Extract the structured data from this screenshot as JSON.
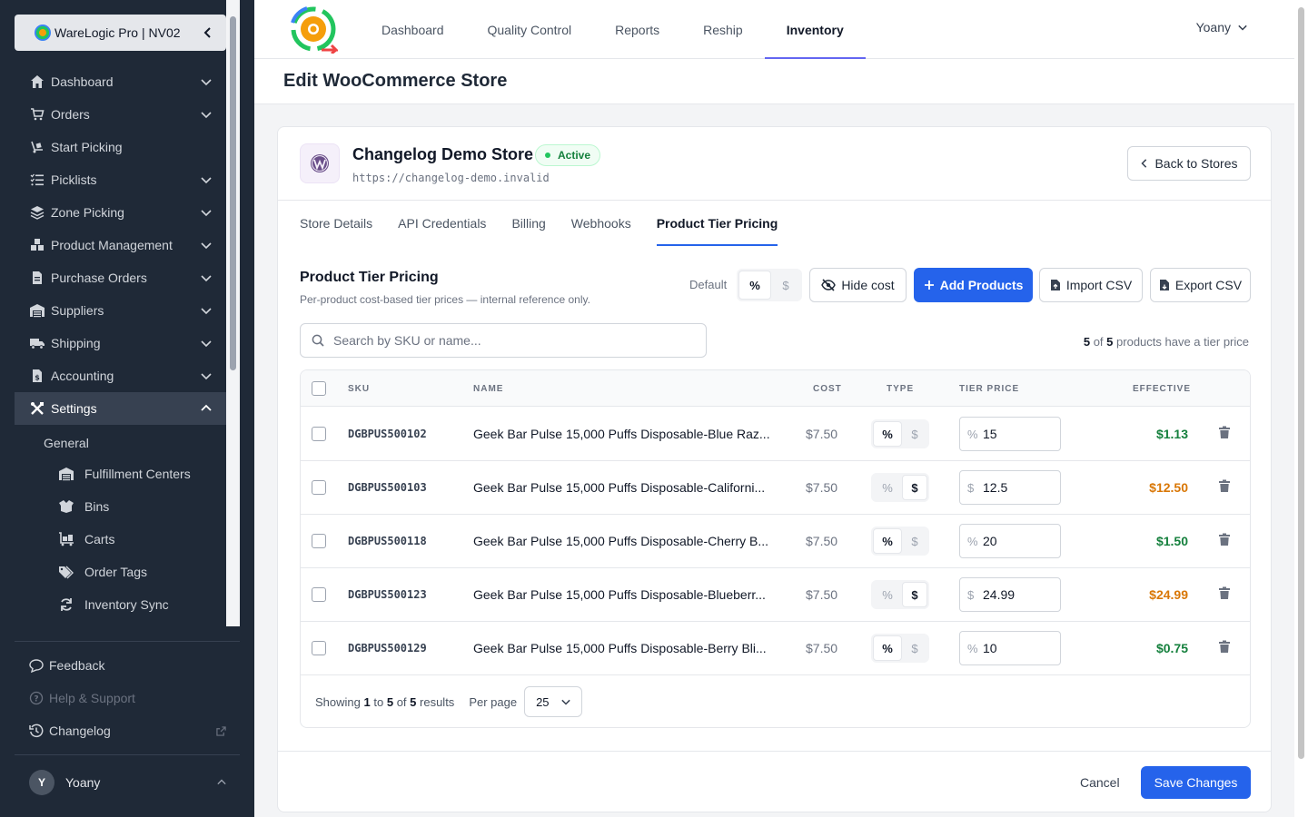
{
  "sidebar": {
    "brand": "WareLogic Pro | NV02",
    "items": [
      {
        "label": "Dashboard",
        "icon": "home-icon"
      },
      {
        "label": "Orders",
        "icon": "cart-icon"
      },
      {
        "label": "Start Picking",
        "icon": "dolly-icon"
      },
      {
        "label": "Picklists",
        "icon": "list-check-icon"
      },
      {
        "label": "Zone Picking",
        "icon": "layers-icon"
      },
      {
        "label": "Product Management",
        "icon": "cubes-icon"
      },
      {
        "label": "Purchase Orders",
        "icon": "file-invoice-icon"
      },
      {
        "label": "Suppliers",
        "icon": "warehouse-icon"
      },
      {
        "label": "Shipping",
        "icon": "truck-icon"
      },
      {
        "label": "Accounting",
        "icon": "file-dollar-icon"
      },
      {
        "label": "Settings",
        "icon": "tools-icon"
      }
    ],
    "general_label": "General",
    "sub_items": [
      {
        "label": "Fulfillment Centers",
        "icon": "warehouse-icon"
      },
      {
        "label": "Bins",
        "icon": "box-open-icon"
      },
      {
        "label": "Carts",
        "icon": "cart-flatbed-icon"
      },
      {
        "label": "Order Tags",
        "icon": "tags-icon"
      },
      {
        "label": "Inventory Sync",
        "icon": "sync-icon"
      }
    ],
    "footer": {
      "feedback": "Feedback",
      "help": "Help & Support",
      "changelog": "Changelog",
      "user_initial": "Y",
      "user_name": "Yoany"
    }
  },
  "topbar": {
    "tabs": [
      "Dashboard",
      "Quality Control",
      "Reports",
      "Reship",
      "Inventory"
    ],
    "active_tab": "Inventory",
    "user": "Yoany"
  },
  "page": {
    "title": "Edit WooCommerce Store"
  },
  "store": {
    "name": "Changelog Demo Store",
    "status": "Active",
    "url": "https://changelog-demo.invalid",
    "back_label": "Back to Stores",
    "tabs": [
      "Store Details",
      "API Credentials",
      "Billing",
      "Webhooks",
      "Product Tier Pricing"
    ],
    "active_tab": "Product Tier Pricing"
  },
  "tier_pricing": {
    "title": "Product Tier Pricing",
    "subtitle": "Per-product cost-based tier prices — internal reference only.",
    "default_label": "Default",
    "percent_symbol": "%",
    "dollar_symbol": "$",
    "hide_cost_label": "Hide cost",
    "add_products_label": "Add Products",
    "import_label": "Import CSV",
    "export_label": "Export CSV",
    "search_placeholder": "Search by SKU or name...",
    "count_num": "5",
    "count_of": "of",
    "count_total": "5",
    "count_suffix": "products have a tier price",
    "columns": {
      "sku": "SKU",
      "name": "NAME",
      "cost": "COST",
      "type": "TYPE",
      "tier": "TIER PRICE",
      "effective": "EFFECTIVE"
    },
    "rows": [
      {
        "sku": "DGBPUS500102",
        "name": "Geek Bar Pulse 15,000 Puffs Disposable-Blue Raz...",
        "cost": "$7.50",
        "type": "%",
        "tier_prefix": "%",
        "tier_value": "15",
        "effective": "$1.13",
        "effective_color": "#15803d"
      },
      {
        "sku": "DGBPUS500103",
        "name": "Geek Bar Pulse 15,000 Puffs Disposable-Californi...",
        "cost": "$7.50",
        "type": "$",
        "tier_prefix": "$",
        "tier_value": "12.5",
        "effective": "$12.50",
        "effective_color": "#d97706"
      },
      {
        "sku": "DGBPUS500118",
        "name": "Geek Bar Pulse 15,000 Puffs Disposable-Cherry B...",
        "cost": "$7.50",
        "type": "%",
        "tier_prefix": "%",
        "tier_value": "20",
        "effective": "$1.50",
        "effective_color": "#15803d"
      },
      {
        "sku": "DGBPUS500123",
        "name": "Geek Bar Pulse 15,000 Puffs Disposable-Blueberr...",
        "cost": "$7.50",
        "type": "$",
        "tier_prefix": "$",
        "tier_value": "24.99",
        "effective": "$24.99",
        "effective_color": "#d97706"
      },
      {
        "sku": "DGBPUS500129",
        "name": "Geek Bar Pulse 15,000 Puffs Disposable-Berry Bli...",
        "cost": "$7.50",
        "type": "%",
        "tier_prefix": "%",
        "tier_value": "10",
        "effective": "$0.75",
        "effective_color": "#15803d"
      }
    ],
    "footer": {
      "showing": "Showing",
      "from": "1",
      "to_word": "to",
      "to": "5",
      "of_word": "of",
      "total": "5",
      "results": "results",
      "per_page_label": "Per page",
      "per_page": "25"
    }
  },
  "actions": {
    "cancel": "Cancel",
    "save": "Save Changes"
  },
  "colors": {
    "primary": "#2563eb",
    "sidebar_bg": "#1f2937",
    "effective_percent": "#15803d",
    "effective_dollar": "#d97706"
  }
}
